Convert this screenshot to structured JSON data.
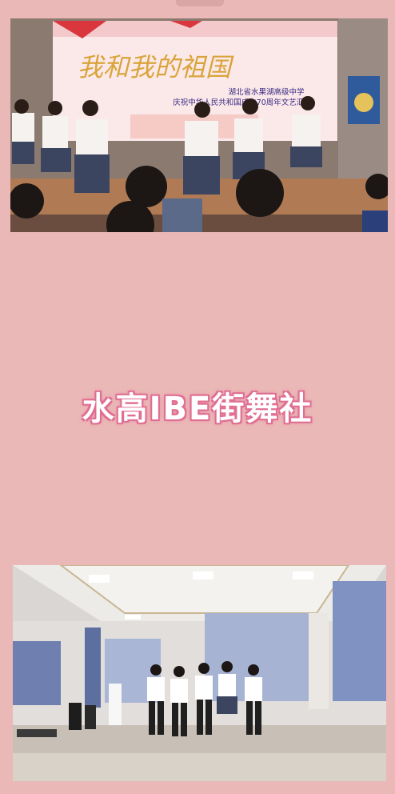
{
  "top_photo": {
    "banner_title": "我和我的祖国",
    "banner_line1": "湖北省水果湖高级中学",
    "banner_line2": "庆祝中华人民共和国成立70周年文艺汇演"
  },
  "caption": "水高IBE街舞社",
  "colors": {
    "background": "#eab8b6",
    "caption_glow": "#e06f93"
  }
}
